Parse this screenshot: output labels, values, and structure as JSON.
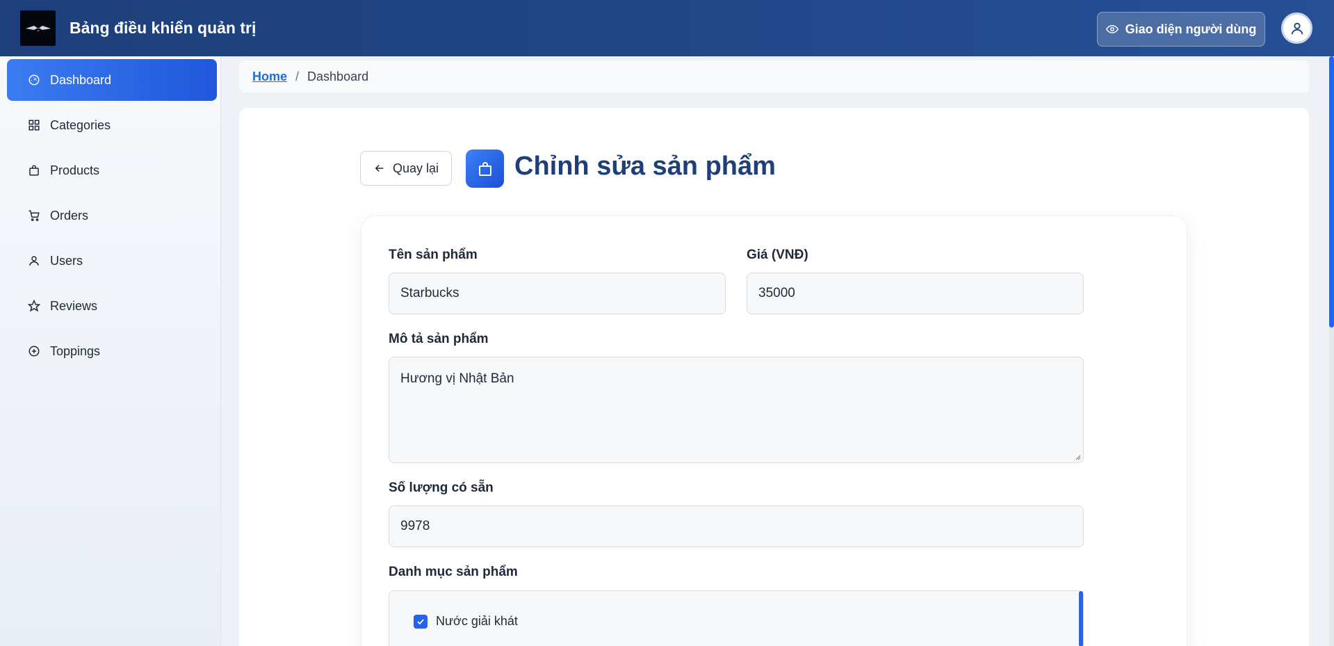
{
  "header": {
    "app_title": "Bảng điều khiển quản trị",
    "user_view_label": "Giao diện người dùng"
  },
  "sidebar": {
    "items": [
      {
        "label": "Dashboard",
        "icon": "gauge-icon",
        "active": true
      },
      {
        "label": "Categories",
        "icon": "grid-icon",
        "active": false
      },
      {
        "label": "Products",
        "icon": "bag-icon",
        "active": false
      },
      {
        "label": "Orders",
        "icon": "cart-icon",
        "active": false
      },
      {
        "label": "Users",
        "icon": "user-icon",
        "active": false
      },
      {
        "label": "Reviews",
        "icon": "star-icon",
        "active": false
      },
      {
        "label": "Toppings",
        "icon": "plus-circle-icon",
        "active": false
      }
    ]
  },
  "breadcrumb": {
    "home": "Home",
    "separator": "/",
    "current": "Dashboard"
  },
  "page": {
    "back_label": "Quay lại",
    "title": "Chỉnh sửa sản phẩm"
  },
  "form": {
    "name_label": "Tên sản phẩm",
    "name_value": "Starbucks",
    "price_label": "Giá (VNĐ)",
    "price_value": "35000",
    "description_label": "Mô tả sản phẩm",
    "description_value": "Hương vị Nhật Bản",
    "stock_label": "Số lượng có sẵn",
    "stock_value": "9978",
    "category_label": "Danh mục sản phẩm",
    "categories": [
      {
        "label": "Nước giải khát",
        "checked": true
      }
    ]
  },
  "colors": {
    "header": "#1e3f79",
    "accent": "#2563eb",
    "title": "#1e3f79"
  }
}
